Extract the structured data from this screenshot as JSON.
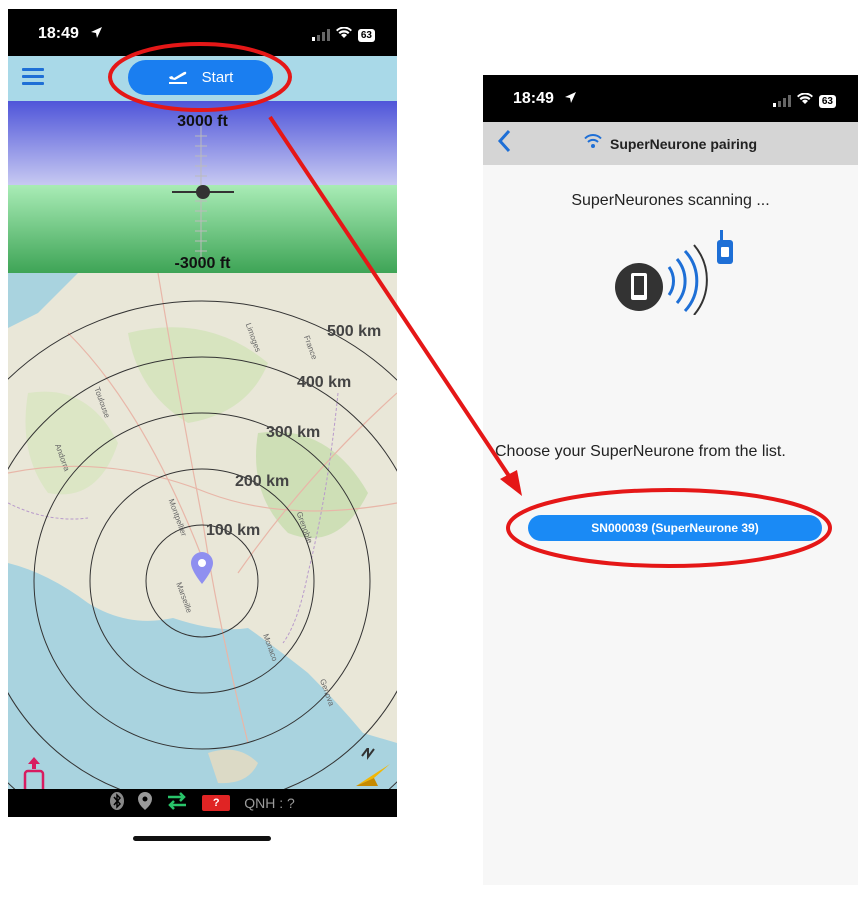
{
  "colors": {
    "accent": "#1a7ef0",
    "annotation": "#e51717",
    "topbar": "#a9d9e8",
    "sky": "#5058d8",
    "ground": "#3ea456",
    "sea": "#a9d3df"
  },
  "left_screen": {
    "status_bar": {
      "time": "18:49",
      "battery": "63"
    },
    "top_bar": {
      "menu_icon": "hamburger-menu-icon",
      "start_icon": "takeoff-icon",
      "start_label": "Start"
    },
    "attitude": {
      "top_altitude": "3000 ft",
      "bottom_altitude": "-3000 ft"
    },
    "map": {
      "range_labels": [
        "500 km",
        "400 km",
        "300 km",
        "200 km",
        "100 km"
      ],
      "place_names": [
        "Toulouse",
        "Montpellier",
        "Marseille",
        "Grenoble",
        "Monaco",
        "Genova",
        "Limoges",
        "France",
        "Andorra"
      ]
    },
    "bottom_bar": {
      "icons": [
        "bluetooth-icon",
        "location-pin-icon",
        "transfer-arrows-icon",
        "battery-warning-icon"
      ],
      "battery_warning": "?",
      "qnh": "QNH : ?"
    }
  },
  "right_screen": {
    "status_bar": {
      "time": "18:49",
      "battery": "63"
    },
    "nav_bar": {
      "back_icon": "back-chevron-icon",
      "title_icon": "wifi-icon",
      "title": "SuperNeurone pairing"
    },
    "scanning_text": "SuperNeurones scanning ...",
    "choose_text": "Choose your SuperNeurone from the list.",
    "device_button": "SN000039 (SuperNeurone 39)"
  }
}
